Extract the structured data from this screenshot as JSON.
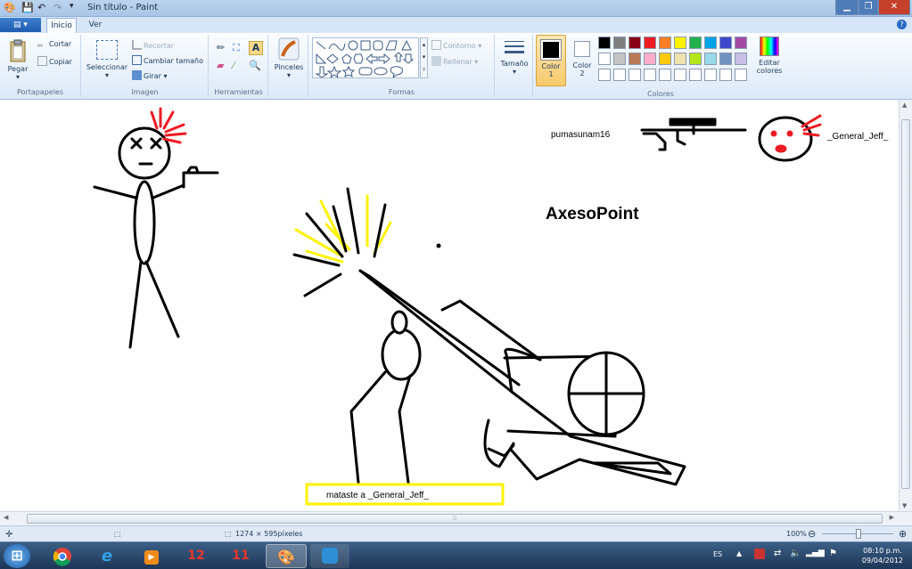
{
  "window": {
    "title": "Sin título - Paint"
  },
  "tabs": {
    "file_label": "▤ ▾",
    "inicio": "Inicio",
    "ver": "Ver"
  },
  "ribbon": {
    "portapapeles": {
      "label": "Portapapeles",
      "pegar": "Pegar",
      "cortar": "Cortar",
      "copiar": "Copiar"
    },
    "imagen": {
      "label": "Imagen",
      "seleccionar": "Seleccionar",
      "recortar": "Recortar",
      "cambiar_tamano": "Cambiar tamaño",
      "girar": "Girar"
    },
    "herramientas": {
      "label": "Herramientas"
    },
    "pinceles": {
      "label": "Pinceles"
    },
    "formas": {
      "label": "Formas",
      "contorno": "Contorno",
      "rellenar": "Rellenar"
    },
    "tamano": {
      "label": "Tamaño"
    },
    "color1": {
      "label_line1": "Color",
      "label_line2": "1"
    },
    "color2": {
      "label_line1": "Color",
      "label_line2": "2"
    },
    "colores": {
      "label": "Colores",
      "editar_line1": "Editar",
      "editar_line2": "colores",
      "palette_row1": [
        "#000000",
        "#7f7f7f",
        "#880015",
        "#ed1c24",
        "#ff7f27",
        "#fff200",
        "#22b14c",
        "#00a2e8",
        "#3f48cc",
        "#a349a4"
      ],
      "palette_row2": [
        "#ffffff",
        "#c3c3c3",
        "#b97a57",
        "#ffaec9",
        "#ffc90e",
        "#efe4b0",
        "#b5e61d",
        "#99d9ea",
        "#7092be",
        "#c8bfe7"
      ]
    }
  },
  "canvas": {
    "player_name": "pumasunam16",
    "victim_name": "_General_Jeff_",
    "brand": "AxesoPoint",
    "kill_message": "mataste a _General_Jeff_"
  },
  "statusbar": {
    "dimensions": "1274 × 595píxeles",
    "zoom": "100%",
    "minus": "⊖",
    "plus": "⊕"
  },
  "taskbar": {
    "lang": "ES",
    "time": "08:10 p.m.",
    "date": "09/04/2012",
    "item_twelve": "12",
    "item_eleven": "11"
  }
}
